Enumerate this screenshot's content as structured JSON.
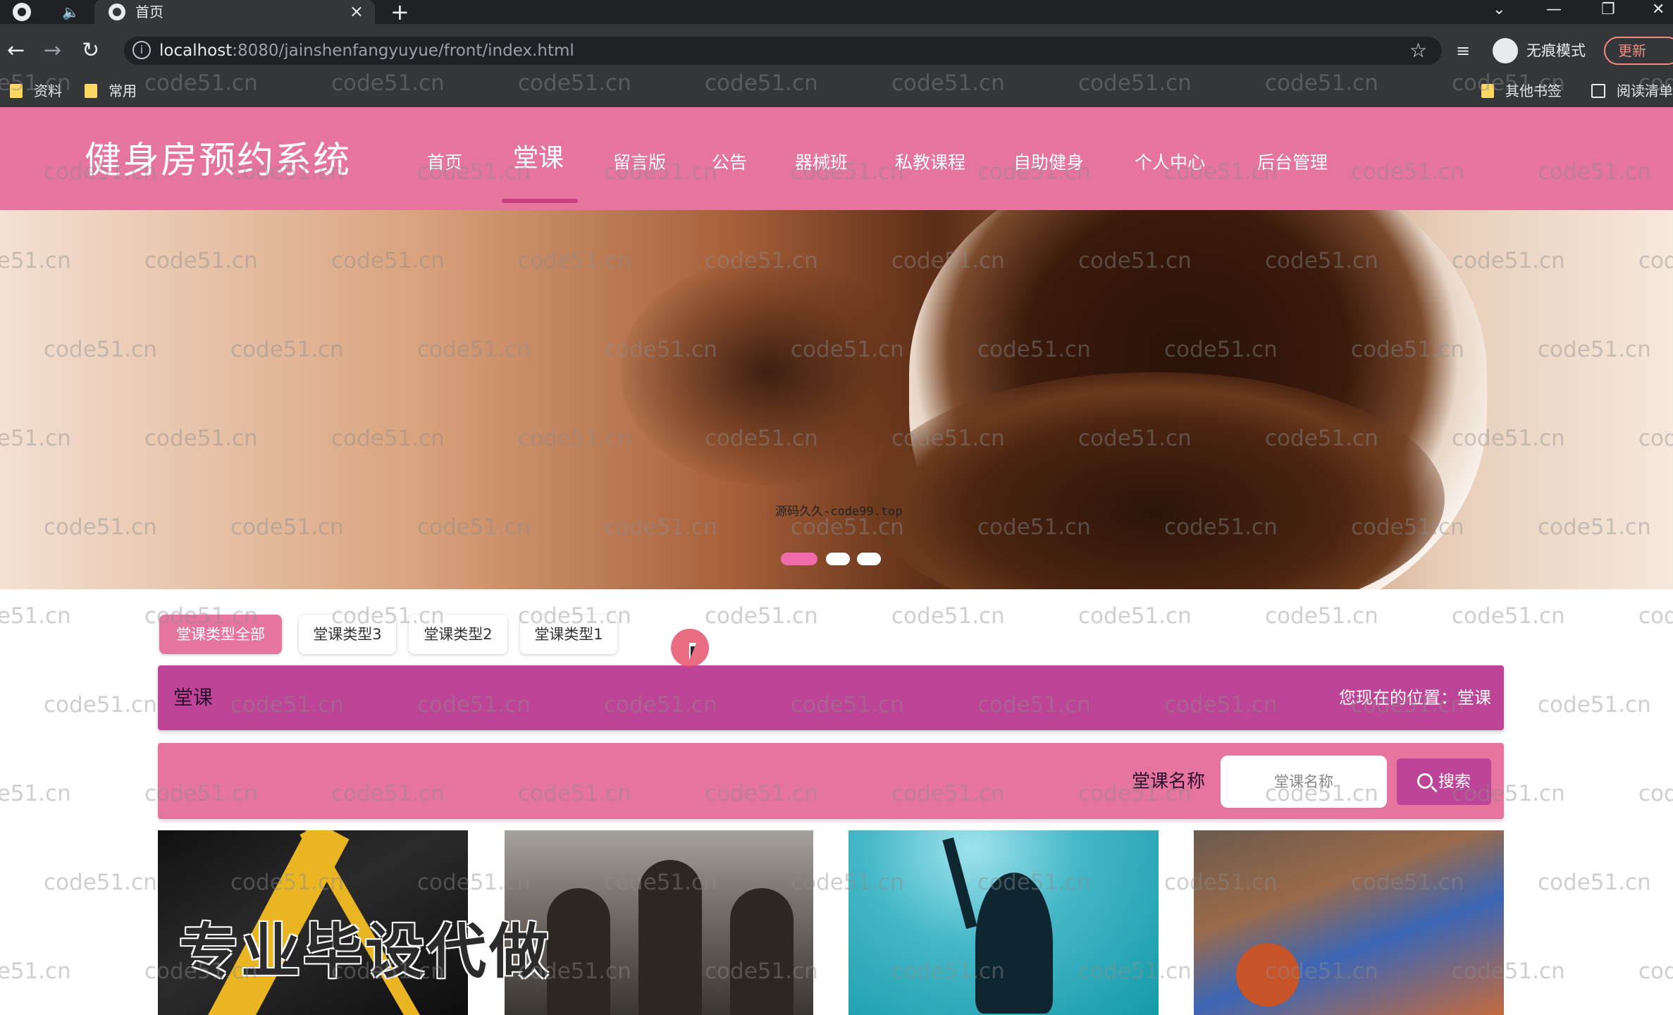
{
  "browser": {
    "tab_title": "首页",
    "tab_close": "×",
    "new_tab": "+",
    "url_host": "localhost",
    "url_path": ":8080/jainshenfangyuyue/front/index.html",
    "incognito_label": "无痕模式",
    "update_label": "更新",
    "window_controls": [
      "⌄",
      "—",
      "❐",
      "✕"
    ],
    "bookmarks": [
      "资料",
      "常用"
    ],
    "other_bookmarks": "其他书签",
    "reading_list": "阅读清单"
  },
  "site": {
    "title": "健身房预约系统",
    "nav": [
      "首页",
      "堂课",
      "留言版",
      "公告",
      "器械班",
      "私教课程",
      "自助健身",
      "个人中心",
      "后台管理"
    ],
    "active_nav_index": 1
  },
  "banner": {
    "caption": "源码久久-code99.top",
    "slide_count": 3,
    "active_slide": 0
  },
  "categories": {
    "items": [
      "堂课类型全部",
      "堂课类型3",
      "堂课类型2",
      "堂课类型1"
    ],
    "active_index": 0
  },
  "section": {
    "title": "堂课",
    "location": "您现在的位置：堂课"
  },
  "search": {
    "label": "堂课名称",
    "placeholder": "堂课名称",
    "button_label": "搜索"
  },
  "overlay_text": "专业毕设代做",
  "watermark_text": "code51.cn",
  "colors": {
    "header_pink": "#e5749e",
    "section_magenta": "#bd4496",
    "active_dot": "#f06ba9"
  }
}
